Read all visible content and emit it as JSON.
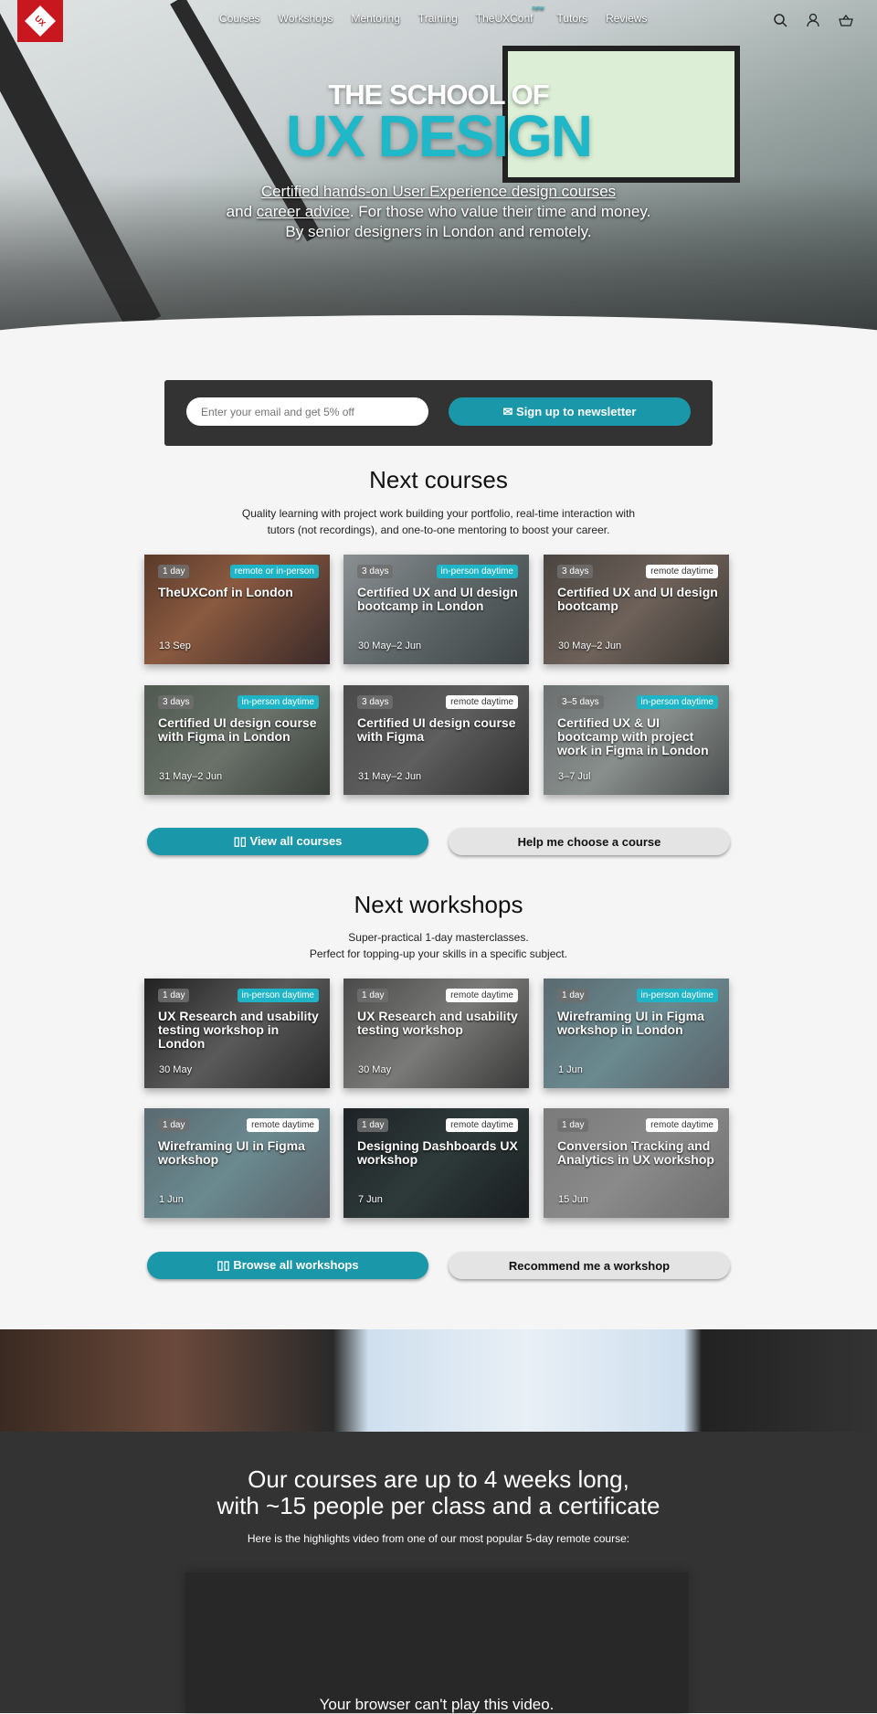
{
  "nav": {
    "logo": "UX",
    "items": [
      "Courses",
      "Workshops",
      "Mentoring",
      "Training",
      "TheUXConf",
      "Tutors",
      "Reviews"
    ],
    "new_badge": "new",
    "icons": [
      "search-icon",
      "user-icon",
      "basket-icon"
    ]
  },
  "hero": {
    "title_small": "THE SCHOOL OF",
    "title_big": "UX DESIGN",
    "line1": "Certified hands-on User Experience design courses",
    "line2a": "and",
    "line2_link": "career advice",
    "line2b": ". For those who value their time and money.",
    "line3": "By senior designers in London and remotely."
  },
  "newsletter": {
    "placeholder": "Enter your email and get 5% off",
    "button": "✉ Sign up to newsletter"
  },
  "courses": {
    "title": "Next courses",
    "subtitle1": "Quality learning with project work building your portfolio, real-time interaction with",
    "subtitle2": "tutors (not recordings), and one-to-one mentoring to boost your career.",
    "cards": [
      {
        "duration": "1 day",
        "mode": "remote or in-person",
        "mode_style": "teal",
        "title": "TheUXConf in London",
        "date": "13 Sep"
      },
      {
        "duration": "3 days",
        "mode": "in-person daytime",
        "mode_style": "teal",
        "title": "Certified UX and UI design bootcamp in London",
        "date": "30 May–2 Jun"
      },
      {
        "duration": "3 days",
        "mode": "remote daytime",
        "mode_style": "white",
        "title": "Certified UX and UI design bootcamp",
        "date": "30 May–2 Jun"
      },
      {
        "duration": "3 days",
        "mode": "in-person daytime",
        "mode_style": "teal",
        "title": "Certified UI design course with Figma in London",
        "date": "31 May–2 Jun"
      },
      {
        "duration": "3 days",
        "mode": "remote daytime",
        "mode_style": "white",
        "title": "Certified UI design course with Figma",
        "date": "31 May–2 Jun"
      },
      {
        "duration": "3–5 days",
        "mode": "in-person daytime",
        "mode_style": "teal",
        "title": "Certified UX & UI bootcamp with project work in Figma in London",
        "date": "3–7 Jul"
      }
    ],
    "primary_button": "▯▯ View all courses",
    "secondary_button": "Help me choose a course"
  },
  "workshops": {
    "title": "Next workshops",
    "subtitle1": "Super-practical 1-day masterclasses.",
    "subtitle2": "Perfect for topping-up your skills in a specific subject.",
    "cards": [
      {
        "duration": "1 day",
        "mode": "in-person daytime",
        "mode_style": "teal",
        "title": "UX Research and usability testing workshop in London",
        "date": "30 May"
      },
      {
        "duration": "1 day",
        "mode": "remote daytime",
        "mode_style": "white",
        "title": "UX Research and usability testing workshop",
        "date": "30 May"
      },
      {
        "duration": "1 day",
        "mode": "in-person daytime",
        "mode_style": "teal",
        "title": "Wireframing UI in Figma workshop in London",
        "date": "1 Jun"
      },
      {
        "duration": "1 day",
        "mode": "remote daytime",
        "mode_style": "white",
        "title": "Wireframing UI in Figma workshop",
        "date": "1 Jun"
      },
      {
        "duration": "1 day",
        "mode": "remote daytime",
        "mode_style": "white",
        "title": "Designing Dashboards UX workshop",
        "date": "7 Jun"
      },
      {
        "duration": "1 day",
        "mode": "remote daytime",
        "mode_style": "white",
        "title": "Conversion Tracking and Analytics in UX workshop",
        "date": "15 Jun"
      }
    ],
    "primary_button": "▯▯ Browse all workshops",
    "secondary_button": "Recommend me a workshop"
  },
  "highlights": {
    "title1": "Our courses are up to 4 weeks long,",
    "title2": "with ~15 people per class and a certificate",
    "subtitle": "Here is the highlights video from one of our most popular 5-day remote course:",
    "video_fallback": "Your browser can't play this video."
  },
  "colors": {
    "accent": "#1a97a8",
    "badge_teal": "#1fb5c7",
    "logo_red": "#c8171e",
    "dark_section": "#333333"
  }
}
